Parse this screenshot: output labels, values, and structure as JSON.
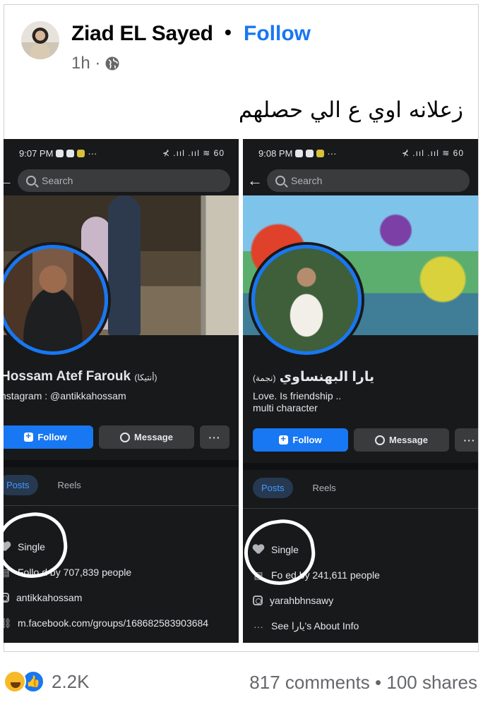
{
  "post": {
    "author": "Ziad EL Sayed",
    "separator": "•",
    "follow_label": "Follow",
    "time": "1h ·",
    "caption": "زعلانه اوي ع الي حصلهم"
  },
  "left_screen": {
    "status_time": "9:07 PM",
    "status_dots": "···",
    "status_right": "⊀ .ııl .ııl ≋ 60",
    "search_placeholder": "Search",
    "name": "Hossam Atef Farouk",
    "name_suffix": "(أنتيكا)",
    "bio_lines": [
      "nstagram : @antikkahossam"
    ],
    "follow_label": "Follow",
    "message_label": "Message",
    "more_label": "···",
    "tabs": [
      "Posts",
      "Reels"
    ],
    "details": [
      {
        "icon": "heart-icon",
        "text": "Single"
      },
      {
        "icon": "followers-icon",
        "text": "Follo    d by 707,839 people"
      },
      {
        "icon": "instagram-icon",
        "text": "antikkahossam"
      },
      {
        "icon": "link-icon",
        "text": "m.facebook.com/groups/168682583903684"
      }
    ]
  },
  "right_screen": {
    "status_time": "9:08 PM",
    "status_dots": "···",
    "status_right": "⊀ .ııl .ııl ≋ 60",
    "search_placeholder": "Search",
    "name": "يارا البهنساوي",
    "name_suffix": "(نجمة)",
    "bio_lines": [
      "Love. Is friendship ..",
      "multi character"
    ],
    "follow_label": "Follow",
    "message_label": "Message",
    "more_label": "···",
    "tabs": [
      "Posts",
      "Reels"
    ],
    "details": [
      {
        "icon": "heart-icon",
        "text": "Single"
      },
      {
        "icon": "followers-icon",
        "text": "Fo     ed by 241,611 people"
      },
      {
        "icon": "instagram-icon",
        "text": "yarahbhnsawy"
      },
      {
        "icon": "more-icon",
        "text": "See يارا's About Info"
      }
    ]
  },
  "footer": {
    "reaction_count": "2.2K",
    "stats": "817 comments • 100 shares"
  },
  "colors": {
    "accent": "#1877f2",
    "dark_bg": "#18191a",
    "muted": "#65676b"
  }
}
